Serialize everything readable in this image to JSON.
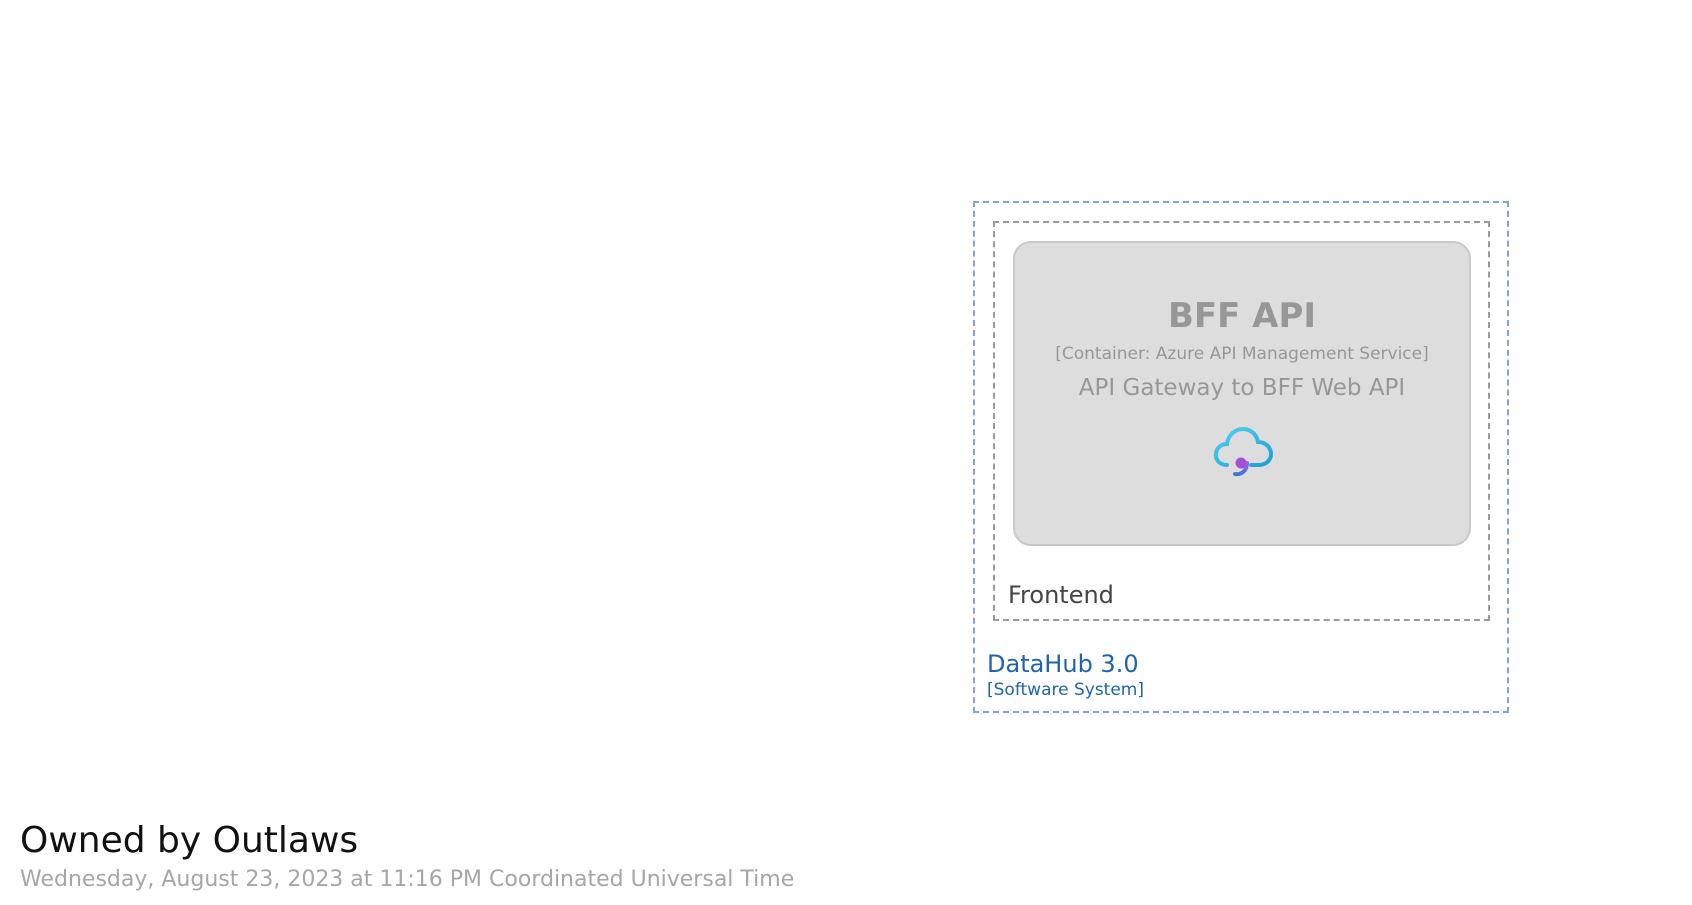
{
  "diagram": {
    "title": "Owned by Outlaws",
    "timestamp": "Wednesday, August 23, 2023 at 11:16 PM Coordinated Universal Time"
  },
  "software_system": {
    "name": "DataHub 3.0",
    "type": "[Software System]",
    "color": "#1f64ad"
  },
  "group": {
    "label": "Frontend"
  },
  "container": {
    "name": "BFF API",
    "technology": "[Container: Azure API Management Service]",
    "description": "API Gateway to BFF Web API",
    "icon": "azure-api-management-icon",
    "fill": "#dddddd"
  }
}
